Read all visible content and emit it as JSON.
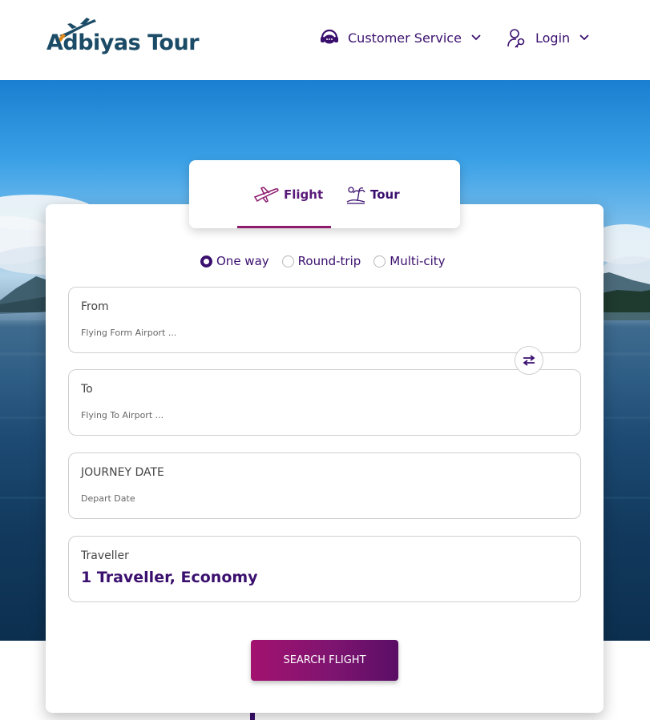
{
  "header": {
    "logo_text": "Adbiyas Tour",
    "nav": {
      "customer_service": "Customer Service",
      "login": "Login"
    },
    "icons": [
      "headset-icon",
      "user-key-icon",
      "chevron-down-icon"
    ]
  },
  "tabs": [
    {
      "label": "Flight",
      "icon": "plane-icon",
      "active": true
    },
    {
      "label": "Tour",
      "icon": "beach-icon",
      "active": false
    }
  ],
  "trip_types": [
    {
      "label": "One way",
      "selected": true
    },
    {
      "label": "Round-trip",
      "selected": false
    },
    {
      "label": "Multi-city",
      "selected": false
    }
  ],
  "fields": {
    "from": {
      "label": "From",
      "placeholder": "Flying Form Airport ..."
    },
    "to": {
      "label": "To",
      "placeholder": "Flying To Airport ..."
    },
    "date": {
      "label": "JOURNEY DATE",
      "placeholder": "Depart Date"
    },
    "traveller": {
      "label": "Traveller",
      "value": "1 Traveller, Economy"
    }
  },
  "search_button": "SEARCH FLIGHT",
  "colors": {
    "brand_purple": "#3a0f6e",
    "accent_magenta": "#a3126f",
    "logo_blue": "#1b4b66",
    "logo_orange": "#e08a1e"
  }
}
